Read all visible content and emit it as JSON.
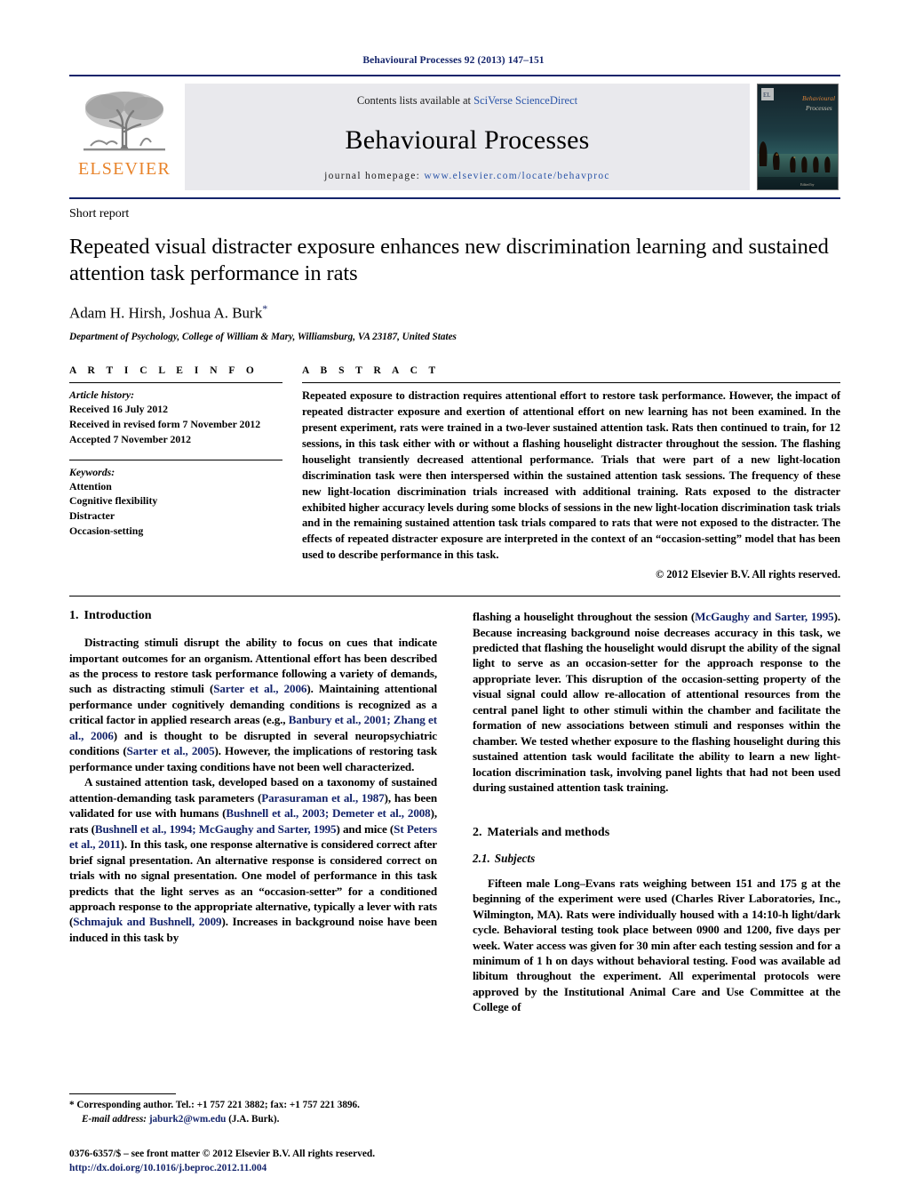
{
  "running_head": "Behavioural Processes 92 (2013) 147–151",
  "banner": {
    "contents_prefix": "Contents lists available at ",
    "sciencedirect": "SciVerse ScienceDirect",
    "journal_name": "Behavioural Processes",
    "homepage_prefix": "journal homepage: ",
    "homepage_url": "www.elsevier.com/locate/behavproc",
    "publisher_logo_text": "ELSEVIER",
    "cover_title_line1": "Behavioural",
    "cover_title_line2": "Processes",
    "accent_blue": "#14246b",
    "link_blue": "#2b55a8",
    "elsevier_orange": "#e8832a",
    "banner_bg": "#e9e9ed"
  },
  "article": {
    "type_label": "Short report",
    "title": "Repeated visual distracter exposure enhances new discrimination learning and sustained attention task performance in rats",
    "authors": "Adam H. Hirsh, Joshua A. Burk",
    "author_star": "*",
    "affiliation": "Department of Psychology, College of William & Mary, Williamsburg, VA 23187, United States"
  },
  "article_info": {
    "heading": "A R T I C L E   I N F O",
    "history_label": "Article history:",
    "history": [
      "Received 16 July 2012",
      "Received in revised form 7 November 2012",
      "Accepted 7 November 2012"
    ],
    "keywords_label": "Keywords:",
    "keywords": [
      "Attention",
      "Cognitive flexibility",
      "Distracter",
      "Occasion-setting"
    ]
  },
  "abstract": {
    "heading": "A B S T R A C T",
    "text": "Repeated exposure to distraction requires attentional effort to restore task performance. However, the impact of repeated distracter exposure and exertion of attentional effort on new learning has not been examined. In the present experiment, rats were trained in a two-lever sustained attention task. Rats then continued to train, for 12 sessions, in this task either with or without a flashing houselight distracter throughout the session. The flashing houselight transiently decreased attentional performance. Trials that were part of a new light-location discrimination task were then interspersed within the sustained attention task sessions. The frequency of these new light-location discrimination trials increased with additional training. Rats exposed to the distracter exhibited higher accuracy levels during some blocks of sessions in the new light-location discrimination task trials and in the remaining sustained attention task trials compared to rats that were not exposed to the distracter. The effects of repeated distracter exposure are interpreted in the context of an “occasion-setting” model that has been used to describe performance in this task.",
    "copyright": "© 2012 Elsevier B.V. All rights reserved."
  },
  "sections": {
    "introduction_heading_num": "1.",
    "introduction_heading": "Introduction",
    "intro_p1_a": "Distracting stimuli disrupt the ability to focus on cues that indicate important outcomes for an organism. Attentional effort has been described as the process to restore task performance following a variety of demands, such as distracting stimuli (",
    "intro_p1_cite1": "Sarter et al., 2006",
    "intro_p1_b": "). Maintaining attentional performance under cognitively demanding conditions is recognized as a critical factor in applied research areas (e.g., ",
    "intro_p1_cite2": "Banbury et al., 2001; Zhang et al., 2006",
    "intro_p1_c": ") and is thought to be disrupted in several neuropsychiatric conditions (",
    "intro_p1_cite3": "Sarter et al., 2005",
    "intro_p1_d": "). However, the implications of restoring task performance under taxing conditions have not been well characterized.",
    "intro_p2_a": "A sustained attention task, developed based on a taxonomy of sustained attention-demanding task parameters (",
    "intro_p2_cite1": "Parasuraman et al., 1987",
    "intro_p2_b": "), has been validated for use with humans (",
    "intro_p2_cite2": "Bushnell et al., 2003; Demeter et al., 2008",
    "intro_p2_c": "), rats (",
    "intro_p2_cite3": "Bushnell et al., 1994; McGaughy and Sarter, 1995",
    "intro_p2_d": ") and mice (",
    "intro_p2_cite4": "St Peters et al., 2011",
    "intro_p2_e": "). In this task, one response alternative is considered correct after brief signal presentation. An alternative response is considered correct on trials with no signal presentation. One model of performance in this task predicts that the light serves as an “occasion-setter” for a conditioned approach response to the appropriate alternative, typically a lever with rats (",
    "intro_p2_cite5": "Schmajuk and Bushnell, 2009",
    "intro_p2_f": "). Increases in background noise have been induced in this task by",
    "intro_p3_a": "flashing a houselight throughout the session (",
    "intro_p3_cite1": "McGaughy and Sarter, 1995",
    "intro_p3_b": "). Because increasing background noise decreases accuracy in this task, we predicted that flashing the houselight would disrupt the ability of the signal light to serve as an occasion-setter for the approach response to the appropriate lever. This disruption of the occasion-setting property of the visual signal could allow re-allocation of attentional resources from the central panel light to other stimuli within the chamber and facilitate the formation of new associations between stimuli and responses within the chamber. We tested whether exposure to the flashing houselight during this sustained attention task would facilitate the ability to learn a new light-location discrimination task, involving panel lights that had not been used during sustained attention task training.",
    "methods_heading_num": "2.",
    "methods_heading": "Materials and methods",
    "subjects_heading_num": "2.1.",
    "subjects_heading": "Subjects",
    "subjects_p1": "Fifteen male Long–Evans rats weighing between 151 and 175 g at the beginning of the experiment were used (Charles River Laboratories, Inc., Wilmington, MA). Rats were individually housed with a 14:10-h light/dark cycle. Behavioral testing took place between 0900 and 1200, five days per week. Water access was given for 30 min after each testing session and for a minimum of 1 h on days without behavioral testing. Food was available ad libitum throughout the experiment. All experimental protocols were approved by the Institutional Animal Care and Use Committee at the College of"
  },
  "footer": {
    "corresponding_star": "*",
    "corresponding_text": " Corresponding author. Tel.: +1 757 221 3882; fax: +1 757 221 3896.",
    "email_label": "E-mail address:",
    "email": "jaburk2@wm.edu",
    "email_suffix": " (J.A. Burk).",
    "issn_line": "0376-6357/$ – see front matter © 2012 Elsevier B.V. All rights reserved.",
    "doi": "http://dx.doi.org/10.1016/j.beproc.2012.11.004"
  }
}
